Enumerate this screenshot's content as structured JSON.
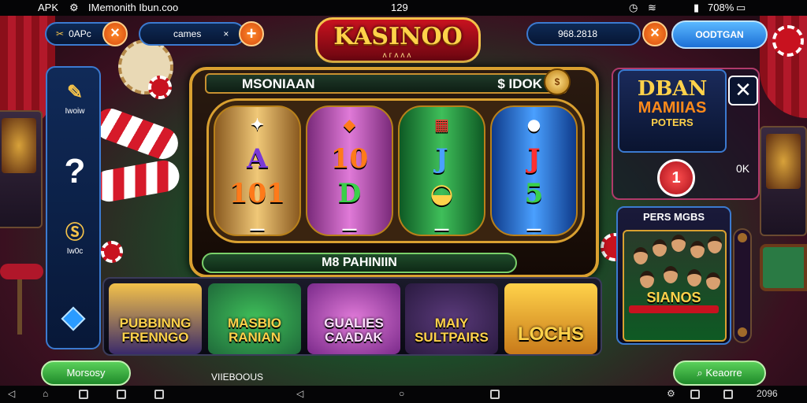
{
  "statusbar": {
    "left": "APK",
    "app_text": "IMemonith Ibun.coo",
    "time": "129",
    "battery": "708%"
  },
  "top": {
    "left_pill": "0APc",
    "mid_pill": "cames",
    "right_pill": "968.2818",
    "blue_button": "OODTGAN"
  },
  "logo": {
    "title": "KASINOO",
    "subtitle": "ᴧᴦᴧᴧᴧ"
  },
  "sidebar": {
    "items": [
      {
        "icon": "ticket-icon",
        "label": "Iwoiw"
      },
      {
        "icon": "question-icon",
        "label": "?"
      },
      {
        "icon": "coin-bag-icon",
        "label": "Iw0c"
      }
    ]
  },
  "slot": {
    "header_title": "MSONIAAN",
    "header_balance": "$ IDOK",
    "footer": "M8 PAHINIIN",
    "reels": [
      [
        "✦",
        "A",
        "101",
        "—"
      ],
      [
        "◆",
        "10",
        "D",
        "—"
      ],
      [
        "▦",
        "J",
        "◒",
        "—"
      ],
      [
        "●",
        "J",
        "5",
        "—"
      ]
    ]
  },
  "promo": {
    "line1": "DBAN",
    "line2": "MAMIIAS",
    "line3": "POTERS",
    "ok": "0K",
    "red_badge": "1"
  },
  "people_panel": {
    "header": "PERS MGBS",
    "title": "SIANOS"
  },
  "tiles": [
    {
      "name": "PUBBINNG FRENNGO",
      "bg": "#3a2a6a"
    },
    {
      "name": "MASBIO RANIAN",
      "bg": "#1f6a3a"
    },
    {
      "name": "GUALIES CAADAK",
      "bg": "#7a2a8a"
    },
    {
      "name": "MAIY SULTPAIRS",
      "bg": "#2a1a40"
    },
    {
      "name": "LOCHS",
      "bg": "#c87a1a"
    }
  ],
  "bottom": {
    "left_button": "Morsosy",
    "center_label": "VIIEBOOUS",
    "right_button": "Keaorre"
  },
  "navbar": {
    "right_text": "2096"
  },
  "colors": {
    "accent_gold": "#f4c24a",
    "panel_blue": "#3b7ad0",
    "cta_green": "#1f8a2a"
  }
}
